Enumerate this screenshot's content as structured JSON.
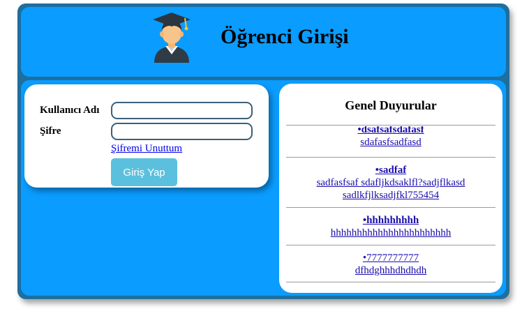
{
  "header": {
    "title": "Öğrenci Girişi",
    "avatar_icon": "graduate-avatar-icon"
  },
  "login": {
    "username_label": "Kullanıcı Adı",
    "username_value": "",
    "password_label": "Şifre",
    "password_value": "",
    "forgot_link": "Şifremi Unuttum",
    "submit_label": "Giriş Yap"
  },
  "announcements": {
    "title": "Genel Duyurular",
    "items": [
      {
        "title": "•dsafsafsdafasf",
        "body1": "sdafasfsadfasd",
        "body2": ""
      },
      {
        "title": "•sadfaf",
        "body1": "sadfasfsaf sdafljkdsaklfl?sadjflkasd",
        "body2": "sadlkfjlksadjfkl755454"
      },
      {
        "title": "•hhhhhhhhh",
        "body1": "hhhhhhhhhhhhhhhhhhhhhhh",
        "body2": ""
      },
      {
        "title": "•7777777777",
        "body1": "dfhdghhhdhdhdh",
        "body2": ""
      }
    ]
  },
  "colors": {
    "frame": "#1e6e9e",
    "panel": "#0a9cff",
    "button": "#5bc0de",
    "link": "#0000ee"
  }
}
